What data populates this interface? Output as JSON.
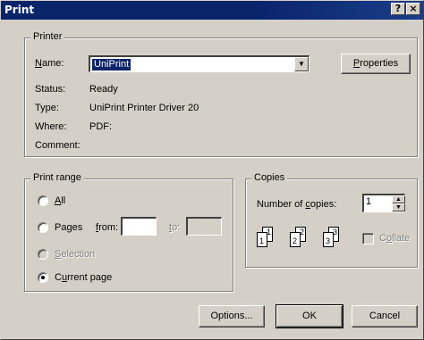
{
  "window": {
    "title": "Print",
    "help_button": "?",
    "close_button": "×"
  },
  "printer": {
    "legend": "Printer",
    "name_label": "Name:",
    "name_value": "UniPrint",
    "properties_button": "Properties",
    "status_label": "Status:",
    "status_value": "Ready",
    "type_label": "Type:",
    "type_value": "UniPrint Printer Driver 20",
    "where_label": "Where:",
    "where_value": "PDF:",
    "comment_label": "Comment:",
    "comment_value": ""
  },
  "print_range": {
    "legend": "Print range",
    "all_label": "All",
    "pages_label": "Pages",
    "from_label": "from:",
    "from_value": "",
    "to_label": "to:",
    "to_value": "",
    "selection_label": "Selection",
    "current_page_label": "Current page",
    "selected": "current_page"
  },
  "copies": {
    "legend": "Copies",
    "number_label": "Number of copies:",
    "number_value": "1",
    "collate_label": "Collate",
    "collate_checked": false,
    "page_numbers": [
      "1",
      "1",
      "2",
      "2",
      "3",
      "3"
    ]
  },
  "buttons": {
    "options": "Options...",
    "ok": "OK",
    "cancel": "Cancel"
  },
  "colors": {
    "titlebar": "#0a246a",
    "face": "#d4d0c8",
    "highlight": "#0a246a"
  }
}
